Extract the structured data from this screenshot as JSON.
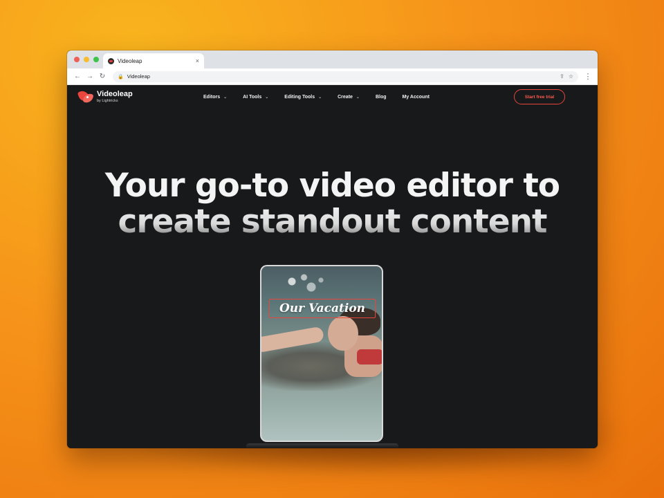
{
  "browser": {
    "tab_title": "Videoleap",
    "tab_close": "×",
    "url": "Videoleap",
    "back": "←",
    "forward": "→",
    "reload": "↻",
    "lock": "🔒",
    "share": "⇪",
    "bookmark": "☆",
    "menu": "⋮"
  },
  "site": {
    "logo_name": "Videoleap",
    "logo_sub": "by Lightricks",
    "nav": [
      {
        "label": "Editors",
        "has_dropdown": true
      },
      {
        "label": "AI Tools",
        "has_dropdown": true
      },
      {
        "label": "Editing Tools",
        "has_dropdown": true
      },
      {
        "label": "Create",
        "has_dropdown": true
      },
      {
        "label": "Blog",
        "has_dropdown": false
      },
      {
        "label": "My Account",
        "has_dropdown": false
      }
    ],
    "chevron": "⌄",
    "cta": "Start free trial"
  },
  "hero": {
    "line1": "Your go-to video editor to",
    "line2": "create standout content"
  },
  "video": {
    "overlay_title": "Our Vacation"
  },
  "colors": {
    "accent": "#e8453c",
    "background": "#18191b"
  }
}
